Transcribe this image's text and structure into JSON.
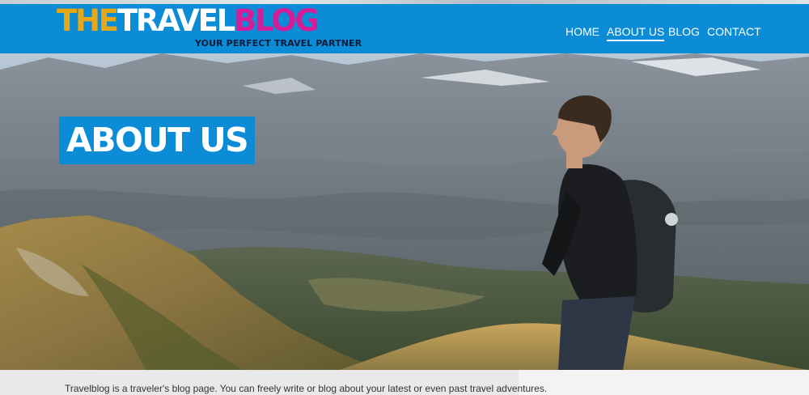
{
  "site": {
    "logo_the": "THE",
    "logo_travel": "TRAVEL",
    "logo_blog": "BLOG",
    "tagline": "YOUR PERFECT TRAVEL PARTNER"
  },
  "nav": {
    "items": [
      {
        "label": "HOME",
        "active": false
      },
      {
        "label": "ABOUT US",
        "active": true
      },
      {
        "label": "BLOG",
        "active": false
      },
      {
        "label": "CONTACT",
        "active": false
      }
    ]
  },
  "hero": {
    "title": "ABOUT US"
  },
  "content": {
    "intro": "Travelblog is a traveler's blog page. You can freely write or blog about your latest or even past travel adventures."
  },
  "colors": {
    "brand_blue": "#0c8bd6",
    "logo_orange": "#e7a817",
    "logo_magenta": "#d61d97"
  }
}
